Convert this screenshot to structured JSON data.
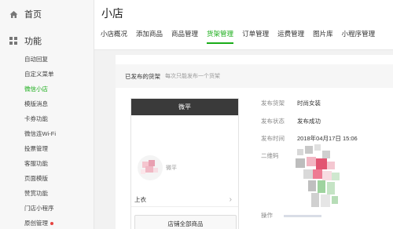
{
  "sidebar": {
    "home_label": "首页",
    "func_label": "功能",
    "items": [
      {
        "label": "自动回复",
        "active": false
      },
      {
        "label": "自定义菜单",
        "active": false
      },
      {
        "label": "微信小店",
        "active": true
      },
      {
        "label": "模版消息",
        "active": false
      },
      {
        "label": "卡券功能",
        "active": false
      },
      {
        "label": "微信连Wi-Fi",
        "active": false
      },
      {
        "label": "投票管理",
        "active": false
      },
      {
        "label": "客服功能",
        "active": false
      },
      {
        "label": "页面模版",
        "active": false
      },
      {
        "label": "赞赏功能",
        "active": false
      },
      {
        "label": "门店小程序",
        "active": false
      },
      {
        "label": "原创管理",
        "active": false,
        "badge": true
      }
    ]
  },
  "header": {
    "title": "小店",
    "tabs": [
      {
        "label": "小店概况",
        "active": false
      },
      {
        "label": "添加商品",
        "active": false
      },
      {
        "label": "商品管理",
        "active": false
      },
      {
        "label": "货架管理",
        "active": true
      },
      {
        "label": "订单管理",
        "active": false
      },
      {
        "label": "运费管理",
        "active": false
      },
      {
        "label": "图片库",
        "active": false
      },
      {
        "label": "小程序管理",
        "active": false
      }
    ]
  },
  "notice": {
    "label": "已发布的货架",
    "hint": "每次只能发布一个货架"
  },
  "preview": {
    "header": "微平",
    "shop_name": "微平",
    "category": "上衣",
    "button": "店铺全部商品"
  },
  "details": {
    "shelf_label": "发布货架",
    "shelf_value": "时尚女装",
    "status_label": "发布状态",
    "status_value": "发布成功",
    "time_label": "发布时间",
    "time_value": "2018年04月17日 15:06",
    "qrcode_label": "二维码",
    "ops_label": "操作"
  },
  "colors": {
    "accent": "#1aad19",
    "badge": "#e64340",
    "phone_header": "#3a3a3a"
  }
}
